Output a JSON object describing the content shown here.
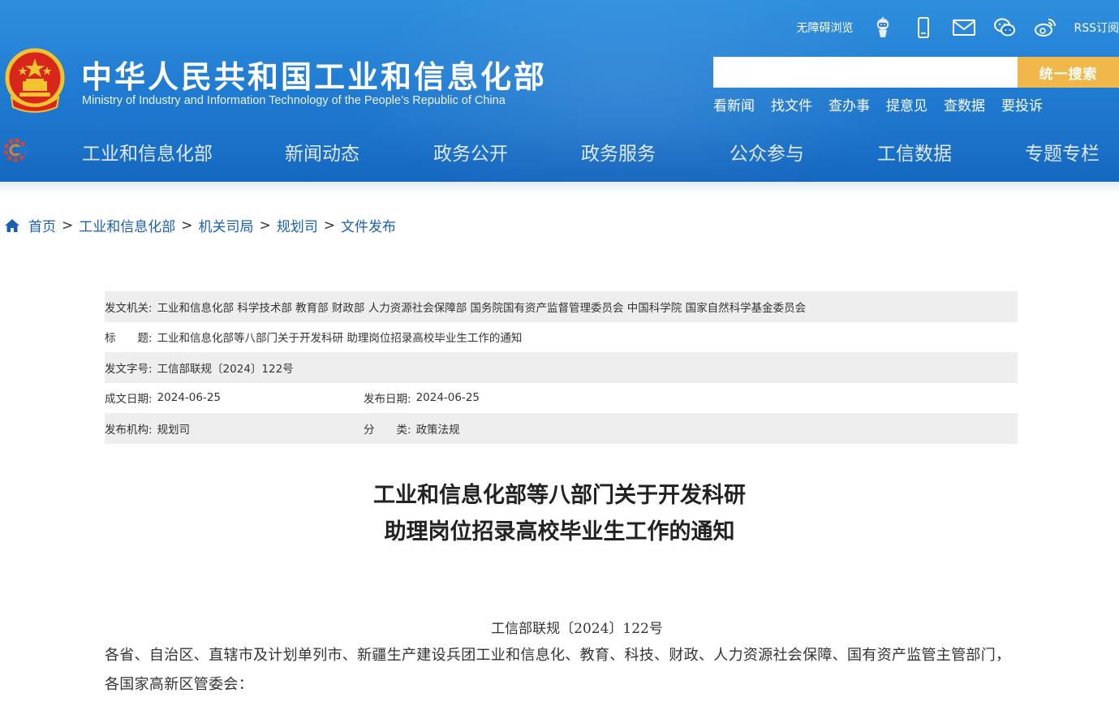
{
  "header": {
    "accessibility": "无障碍浏览",
    "rss": "RSS订阅",
    "top_icons": [
      "robot-icon",
      "mobile-icon",
      "mail-icon",
      "wechat-icon",
      "weibo-icon"
    ],
    "title": "中华人民共和国工业和信息化部",
    "subtitle": "Ministry of Industry and Information Technology of the People’s Republic of China",
    "search": {
      "value": "",
      "button": "统一搜索"
    },
    "quick_links": [
      "看新闻",
      "找文件",
      "查办事",
      "提意见",
      "查数据",
      "要投诉"
    ]
  },
  "nav": {
    "items": [
      "工业和信息化部",
      "新闻动态",
      "政务公开",
      "政务服务",
      "公众参与",
      "工信数据",
      "专题专栏"
    ]
  },
  "breadcrumb": {
    "items": [
      "首页",
      "工业和信息化部",
      "机关司局",
      "规划司",
      "文件发布"
    ],
    "separator": ">"
  },
  "info": {
    "issuer_label": "发文机关:",
    "issuer": "工业和信息化部 科学技术部 教育部 财政部 人力资源社会保障部 国务院国有资产监督管理委员会 中国科学院 国家自然科学基金委员会",
    "title_label": "标　　题:",
    "title": "工业和信息化部等八部门关于开发科研 助理岗位招录高校毕业生工作的通知",
    "doc_no_label": "发文字号:",
    "doc_no": "工信部联规〔2024〕122号",
    "written_date_label": "成文日期:",
    "written_date": "2024-06-25",
    "publish_date_label": "发布日期:",
    "publish_date": "2024-06-25",
    "org_label": "发布机构:",
    "org": "规划司",
    "category_label": "分　　类:",
    "category": "政策法规"
  },
  "article": {
    "title_line1": "工业和信息化部等八部门关于开发科研",
    "title_line2": "助理岗位招录高校毕业生工作的通知",
    "doc_number": "工信部联规〔2024〕122号",
    "body": "各省、自治区、直辖市及计划单列市、新疆生产建设兵团工业和信息化、教育、科技、财政、人力资源社会保障、国有资产监管主管部门，各国家高新区管委会："
  },
  "colors": {
    "header_blue": "#1f79cf",
    "search_button": "#f0b74a",
    "link_blue": "#1a5fb4",
    "row_shade": "#eeeeee"
  }
}
